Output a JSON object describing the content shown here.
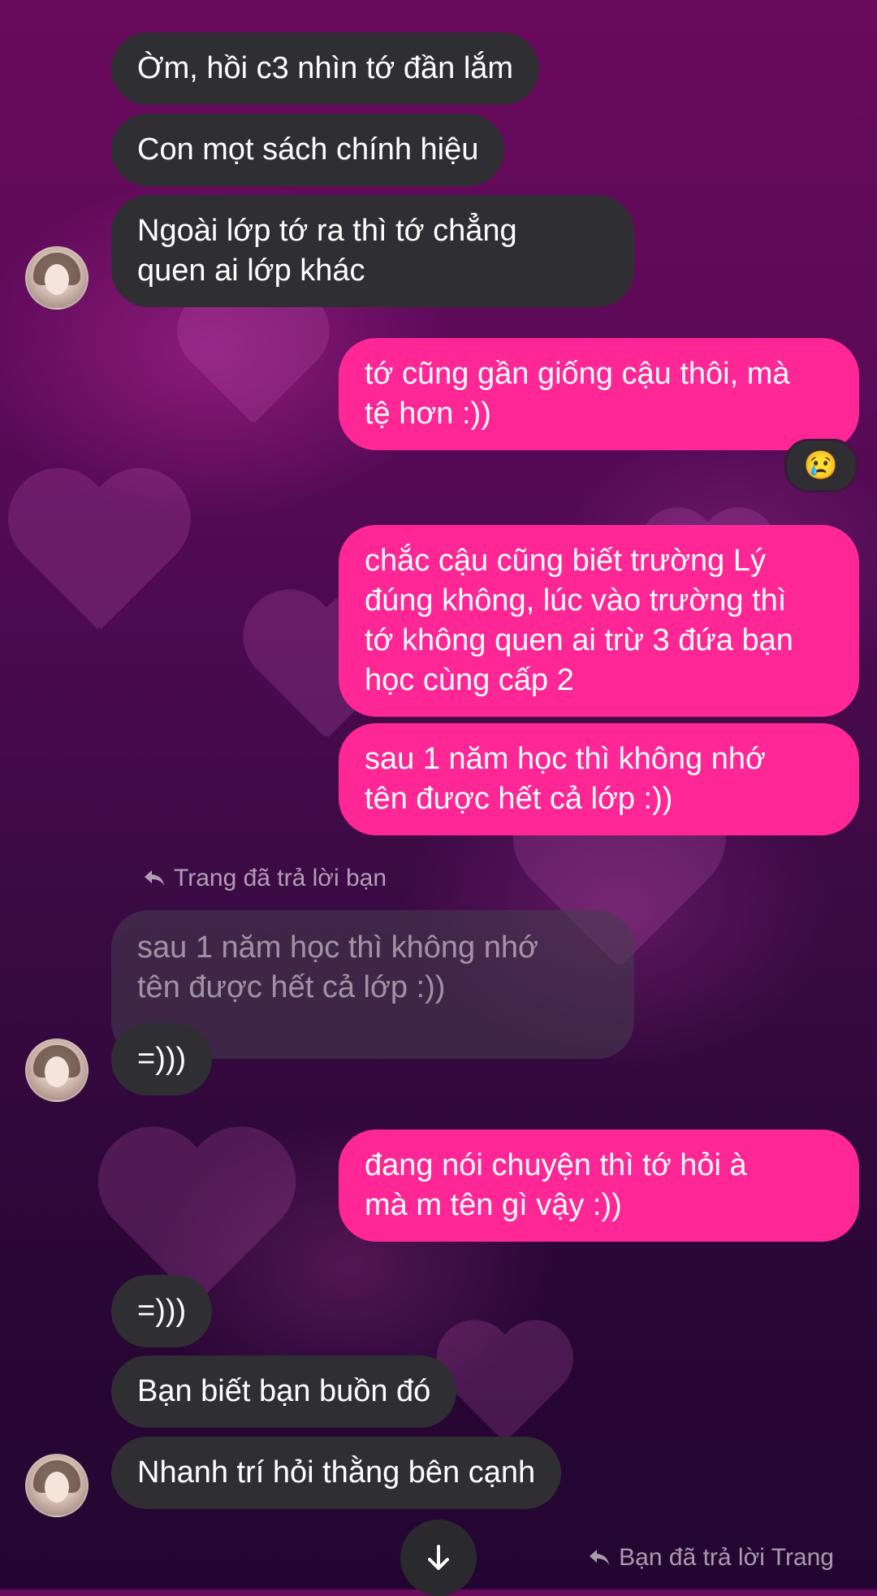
{
  "colors": {
    "incoming_bubble": "#2f2f33",
    "outgoing_bubble": "#ff2796",
    "text": "#ffffff"
  },
  "messages": [
    {
      "from": "them",
      "text": "Ờm, hồi c3 nhìn tớ đần lắm"
    },
    {
      "from": "them",
      "text": "Con mọt sách chính hiệu"
    },
    {
      "from": "them",
      "text": "Ngoài lớp tớ ra thì tớ chẳng\nquen ai lớp khác"
    },
    {
      "from": "me",
      "text": "tớ cũng gần giống cậu thôi, mà\ntệ hơn :))"
    },
    {
      "from": "me",
      "text": "chắc cậu cũng biết trường Lý\nđúng không, lúc vào trường thì\ntớ không quen ai trừ 3 đứa bạn\nhọc cùng cấp 2"
    },
    {
      "from": "me",
      "text": "sau 1 năm học thì không nhớ\ntên được hết cả lớp :))"
    },
    {
      "from": "them",
      "text": "=)))"
    },
    {
      "from": "me",
      "text": "đang nói chuyện thì tớ hỏi à\nmà m tên gì vậy :))"
    },
    {
      "from": "them",
      "text": "=)))"
    },
    {
      "from": "them",
      "text": "Bạn biết bạn buồn đó"
    },
    {
      "from": "them",
      "text": "Nhanh trí hỏi thằng bên cạnh"
    }
  ],
  "reaction": {
    "emoji": "😢",
    "icon": "crying-face-emoji"
  },
  "reply_1": {
    "label": "Trang đã trả lời bạn",
    "quoted_text": "sau 1 năm học thì không nhớ\ntên được hết cả lớp :))"
  },
  "reply_2": {
    "label": "Bạn đã trả lời Trang"
  },
  "scroll_button": {
    "icon": "arrow-down-icon"
  }
}
